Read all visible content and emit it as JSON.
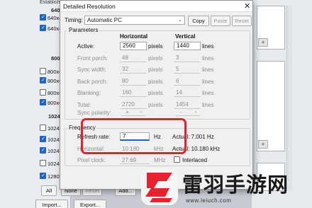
{
  "background": {
    "left_title": "Establishe",
    "groups": [
      "640",
      "800",
      "1024"
    ],
    "items": [
      {
        "label": "640x4",
        "checked": true
      },
      {
        "label": "640x4",
        "checked": true
      },
      {
        "label": "800x6",
        "checked": false
      },
      {
        "label": "800x6",
        "checked": true
      },
      {
        "label": "800x6",
        "checked": false
      },
      {
        "label": "800x6",
        "checked": true
      },
      {
        "label": "1024x",
        "checked": false
      },
      {
        "label": "1024x",
        "checked": true
      },
      {
        "label": "1024x",
        "checked": true
      },
      {
        "label": "1024x",
        "checked": false
      },
      {
        "label": "1280x",
        "checked": true
      }
    ],
    "buttons": {
      "all": "All",
      "none": "None",
      "reset": "Reset",
      "add": "Add...",
      "import": "Import...",
      "export": "Export..."
    },
    "plus": "+"
  },
  "dialog": {
    "title": "Detailed Resolution",
    "close": "✕",
    "timing_label": "Timing:",
    "timing_value": "Automatic PC",
    "copy": "Copy",
    "paste": "Paste",
    "reset": "Reset",
    "parameters": {
      "group_label": "Parameters",
      "col_horizontal": "Horizontal",
      "col_vertical": "Vertical",
      "rows": [
        {
          "label": "Active:",
          "h": "2560",
          "h_unit": "pixels",
          "v": "1440",
          "v_unit": "lines"
        },
        {
          "label": "Front porch:",
          "h": "48",
          "h_unit": "pixels",
          "v": "3",
          "v_unit": "lines"
        },
        {
          "label": "Sync width:",
          "h": "32",
          "h_unit": "pixels",
          "v": "5",
          "v_unit": "lines"
        },
        {
          "label": "Back porch:",
          "h": "80",
          "h_unit": "pixels",
          "v": "6",
          "v_unit": "lines"
        },
        {
          "label": "Blanking:",
          "h": "160",
          "h_unit": "pixels",
          "v": "14",
          "v_unit": "lines"
        },
        {
          "label": "Total:",
          "h": "2720",
          "h_unit": "pixels",
          "v": "1454",
          "v_unit": "lines"
        }
      ],
      "sync_polarity_label": "Sync polarity:",
      "sync_h": "+",
      "sync_v": "-"
    },
    "frequency": {
      "group_label": "Frequency",
      "refresh_label": "Refresh rate:",
      "refresh_value": "7",
      "refresh_unit": "Hz",
      "refresh_actual": "Actual: 7.001 Hz",
      "horizontal_label": "Horizontal:",
      "horizontal_value": "10.180",
      "horizontal_unit": "kHz",
      "horizontal_actual": "Actual: 10.180 kHz",
      "pixel_clock_label": "Pixel clock:",
      "pixel_clock_value": "27.69",
      "pixel_clock_unit": "MHz",
      "interlaced_label": "Interlaced"
    }
  },
  "watermark": {
    "text": "雷羽手游网",
    "url": "www.leiuch.com"
  },
  "colors": {
    "highlight": "#e0242e",
    "accent": "#1f64c6",
    "logo_red": "#e8232f"
  }
}
